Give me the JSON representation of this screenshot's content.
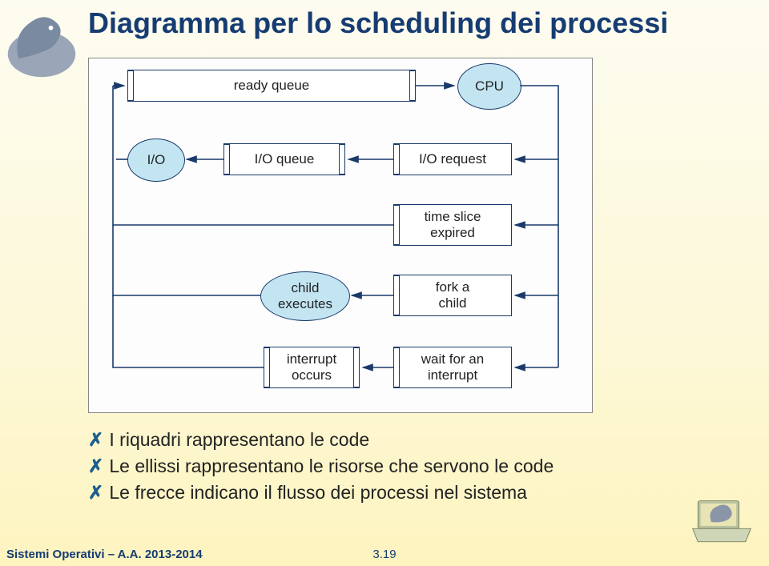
{
  "title": "Diagramma per lo scheduling dei processi",
  "diagram": {
    "ready_queue": "ready queue",
    "cpu": "CPU",
    "io": "I/O",
    "io_queue": "I/O queue",
    "io_request": "I/O request",
    "time_slice": "time slice\nexpired",
    "child_executes": "child\nexecutes",
    "fork_child": "fork a\nchild",
    "interrupt_occurs": "interrupt\noccurs",
    "wait_interrupt": "wait for an\ninterrupt"
  },
  "bullets": [
    "I riquadri rappresentano le code",
    "Le ellissi rappresentano le risorse che servono le code",
    "Le frecce indicano il flusso dei processi nel sistema"
  ],
  "footer": {
    "left": "Sistemi Operativi – A.A. 2013-2014",
    "page": "3.19"
  },
  "icons": {
    "dino": "dinosaur-logo",
    "laptop": "dinosaur-laptop"
  }
}
